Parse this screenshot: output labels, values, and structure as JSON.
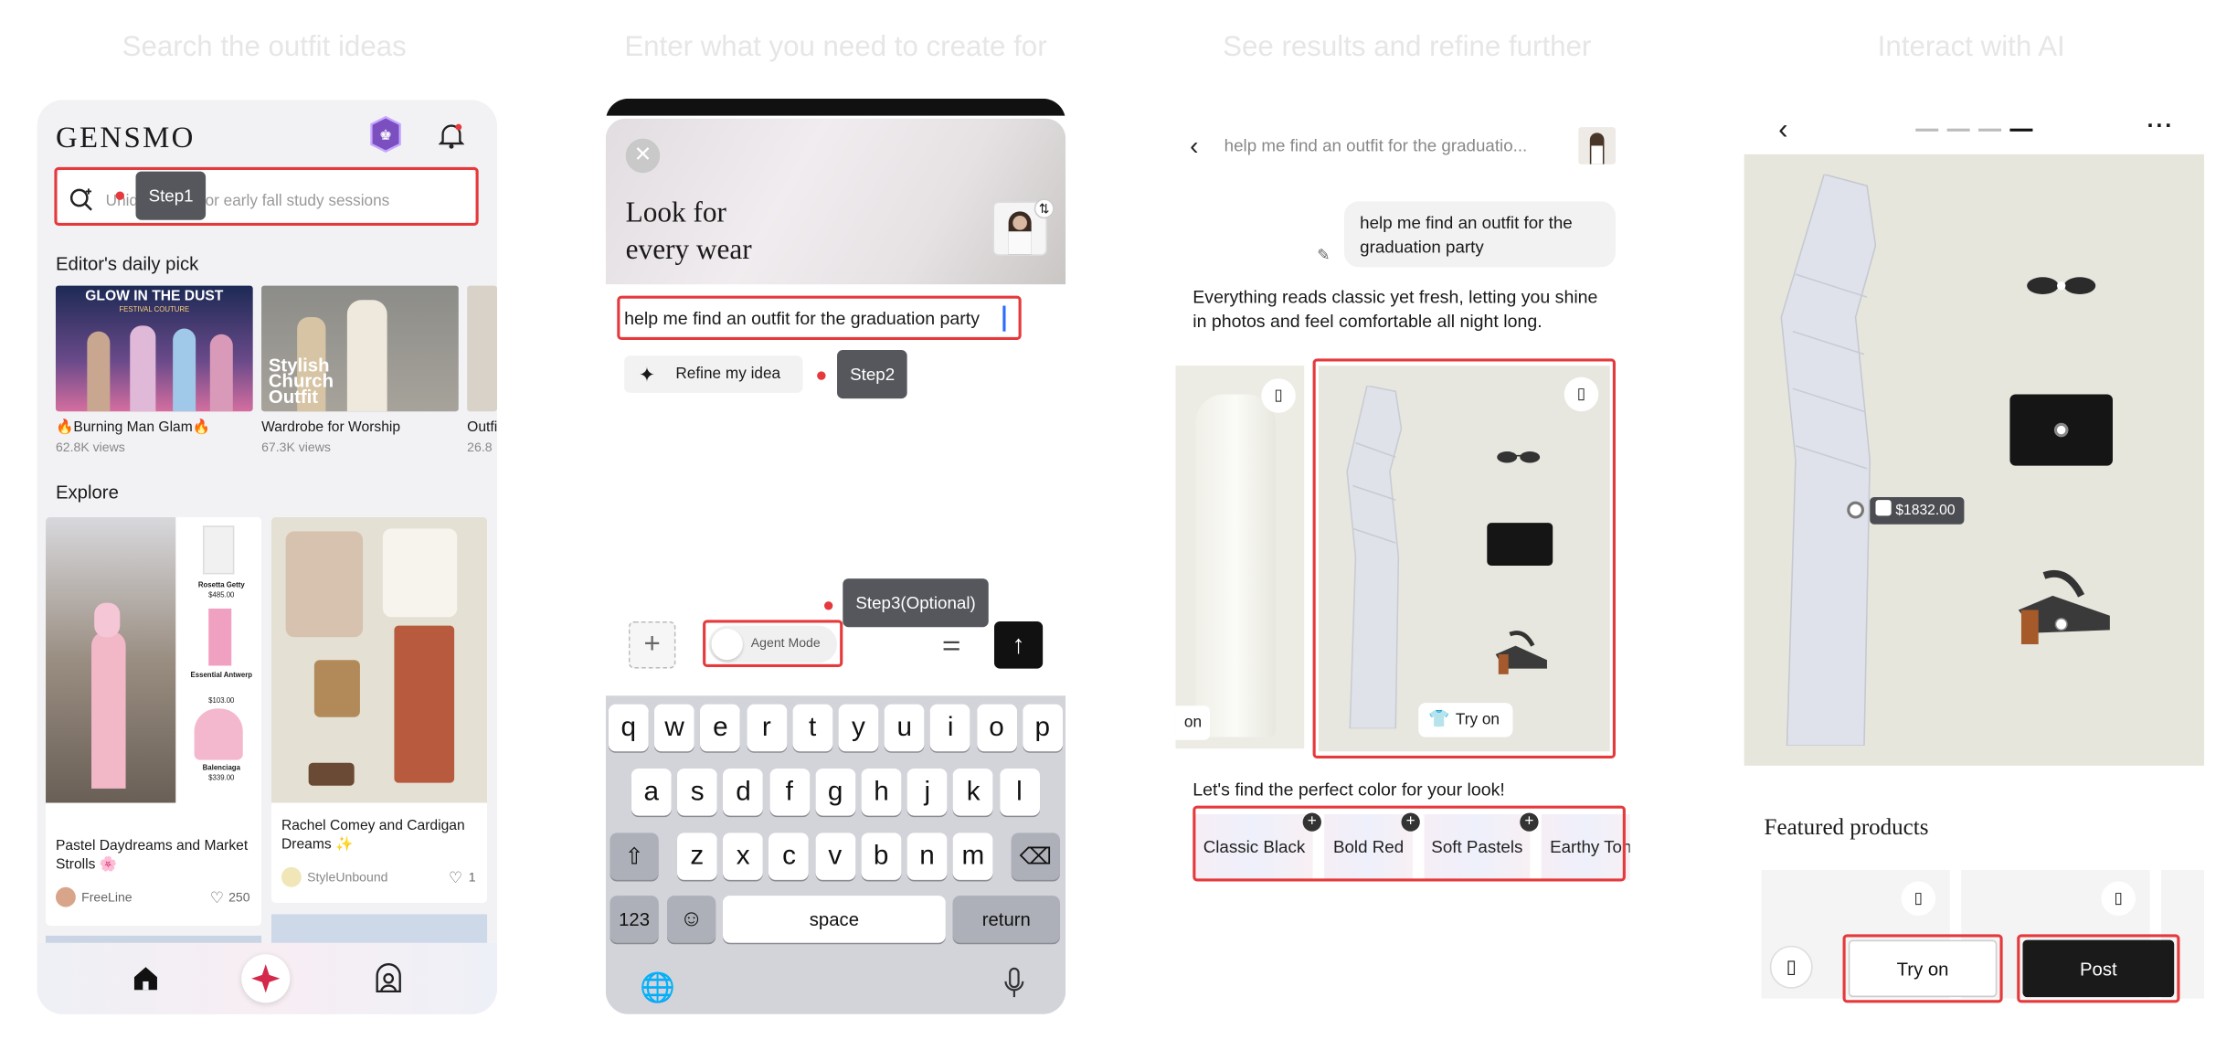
{
  "captions": [
    "Search the outfit ideas",
    "Enter what you need to create for",
    "See results and refine further",
    "Interact with AI"
  ],
  "panel1": {
    "logo": "GENSMO",
    "search_placeholder": "Unique skirts for early fall study sessions",
    "step_label": "Step1",
    "editors_pick_title": "Editor's daily pick",
    "picks": [
      {
        "title": "🔥Burning Man Glam🔥",
        "views": "62.8K views",
        "image_text": "GLOW IN THE DUST",
        "image_subtext": "FESTIVAL COUTURE"
      },
      {
        "title": "Wardrobe for Worship",
        "views": "67.3K views",
        "image_text": "Stylish Church Outfit"
      },
      {
        "title": "Outfi",
        "views": "26.8"
      }
    ],
    "explore_title": "Explore",
    "explore": [
      {
        "title": "Pastel Daydreams and Market Strolls 🌸",
        "user": "FreeLine",
        "likes": "250",
        "products": [
          {
            "brand": "Rosetta Getty",
            "price": "$485.00"
          },
          {
            "brand": "Essential Antwerp",
            "price": "$103.00"
          },
          {
            "brand": "Balenciaga",
            "price": "$339.00"
          }
        ]
      },
      {
        "title": "Rachel Comey and Cardigan Dreams ✨",
        "user": "StyleUnbound",
        "likes": "1"
      }
    ],
    "accent": "#e5393c"
  },
  "panel2": {
    "header_title_line1": "Look for",
    "header_title_line2": "every wear",
    "prompt_text": "help me find an outfit for the graduation party",
    "refine_label": "Refine my idea",
    "step2_label": "Step2",
    "step3_label": "Step3(Optional)",
    "agent_mode_label": "Agent Mode",
    "keyboard": {
      "row1": [
        "q",
        "w",
        "e",
        "r",
        "t",
        "y",
        "u",
        "i",
        "o",
        "p"
      ],
      "row2": [
        "a",
        "s",
        "d",
        "f",
        "g",
        "h",
        "j",
        "k",
        "l"
      ],
      "row3": [
        "z",
        "x",
        "c",
        "v",
        "b",
        "n",
        "m"
      ],
      "num_label": "123",
      "space_label": "space",
      "return_label": "return"
    }
  },
  "panel3": {
    "header_title": "help me find an outfit for the graduatio...",
    "user_message": "help me find an outfit for the graduation party",
    "ai_message": "Everything reads classic yet fresh, letting you shine in photos and feel comfortable all night long.",
    "left_try_label": "on",
    "try_on_label": "Try on",
    "color_prompt": "Let's find the perfect color for your look!",
    "colors": [
      "Classic Black",
      "Bold Red",
      "Soft Pastels",
      "Earthy Tone"
    ]
  },
  "panel4": {
    "price_tag": "$1832.00",
    "featured_title": "Featured products",
    "try_on_label": "Try on",
    "post_label": "Post"
  }
}
